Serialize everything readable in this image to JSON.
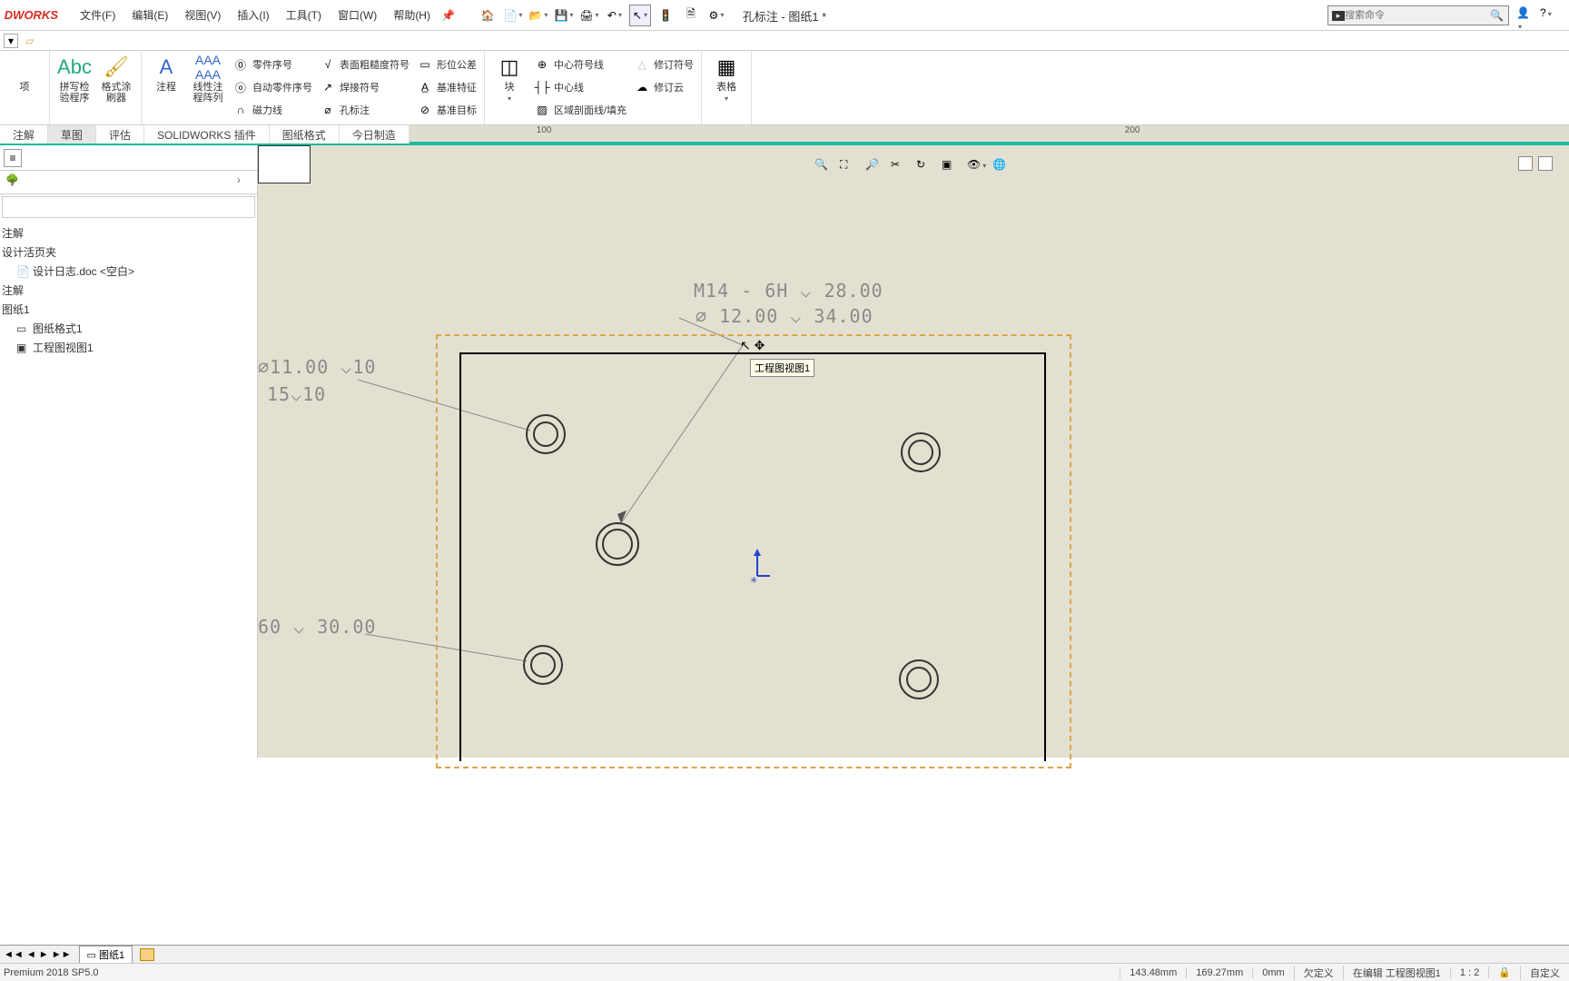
{
  "logo": "DWORKS",
  "menu": {
    "file": "文件(F)",
    "edit": "编辑(E)",
    "view": "视图(V)",
    "insert": "插入(I)",
    "tools": "工具(T)",
    "window": "窗口(W)",
    "help": "帮助(H)"
  },
  "title": "孔标注 - 图纸1 *",
  "search_placeholder": "搜索命令",
  "ribbon": {
    "options": "项",
    "spellcheck": "拼写检\n验程序",
    "format_painter": "格式涂\n刷器",
    "annot": "注程",
    "linear_pattern": "线性注\n程阵列",
    "balloon": "零件序号",
    "auto_balloon": "自动零件序号",
    "magnetic_line": "磁力线",
    "surface_finish": "表面粗糙度符号",
    "weld_symbol": "焊接符号",
    "hole_callout": "孔标注",
    "geo_tol": "形位公差",
    "datum_feature": "基准特征",
    "datum_target": "基准目标",
    "block": "块",
    "center_mark": "中心符号线",
    "centerline": "中心线",
    "area_hatch": "区域剖面线/填充",
    "rev_symbol": "修订符号",
    "rev_cloud": "修订云",
    "table": "表格"
  },
  "tabs": {
    "annot": "注解",
    "sketch": "草图",
    "eval": "评估",
    "addins": "SOLIDWORKS 插件",
    "sheetfmt": "图纸格式",
    "today": "今日制造"
  },
  "ruler": {
    "m100": "100",
    "m200": "200"
  },
  "tree": {
    "annotations": "注解",
    "design_binder": "设计活页夹",
    "design_journal": "设计日志.doc <空白>",
    "notes": "注解",
    "sheet1": "图纸1",
    "sheet_format": "图纸格式1",
    "drawing_view": "工程图视图1"
  },
  "drawing": {
    "callout1_a": "M14 - 6H ⌵ 28.00",
    "callout1_b": "⌀ 12.00 ⌵ 34.00",
    "callout2_a": "⌀11.00 ⌵10",
    "callout2_b": "15⌵10",
    "callout3": "60 ⌵ 30.00",
    "tooltip": "工程图视图1"
  },
  "sheet_tab": "图纸1",
  "status": {
    "version": "Premium 2018 SP5.0",
    "x": "143.48mm",
    "y": "169.27mm",
    "z": "0mm",
    "under": "欠定义",
    "editing": "在编辑 工程图视图1",
    "scale": "1 : 2",
    "custom": "自定义"
  }
}
